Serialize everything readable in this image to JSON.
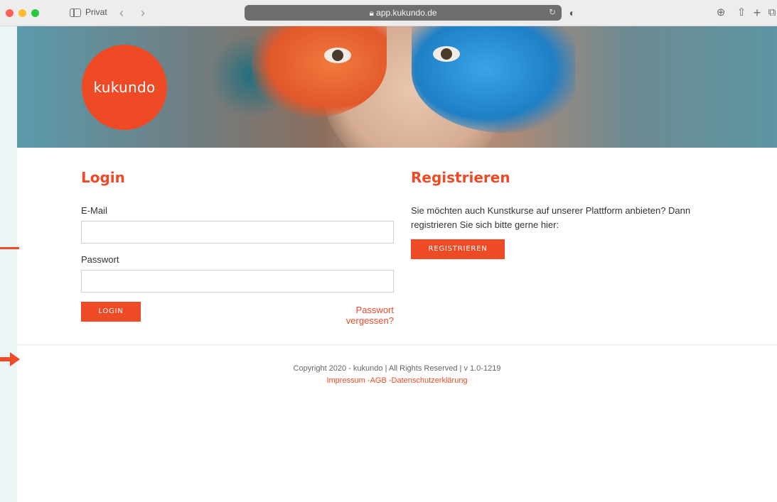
{
  "browser": {
    "private_label": "Privat",
    "url": "app.kukundo.de",
    "nav_back": "‹",
    "nav_forward": "›",
    "icons": [
      "sidebar-icon",
      "back-icon",
      "forward-icon",
      "lock-icon",
      "reload-icon",
      "shield-icon",
      "download-icon",
      "share-icon",
      "new-tab-icon",
      "tabs-icon"
    ]
  },
  "brand": {
    "logo_text": "kukundo",
    "accent": "#ef4a26"
  },
  "login": {
    "title": "Login",
    "email_label": "E-Mail",
    "email_value": "",
    "password_label": "Passwort",
    "password_value": "",
    "button_label": "LOGIN",
    "forgot_label": "Passwort vergessen?"
  },
  "register": {
    "title": "Registrieren",
    "text": "Sie möchten auch Kunstkurse auf unserer Plattform anbieten? Dann registrieren Sie sich bitte gerne hier:",
    "button_label": "REGISTRIEREN"
  },
  "footer": {
    "copyright": "Copyright 2020 - kukundo | All Rights Reserved | v 1.0-1219",
    "impressum": "Impressum",
    "separator_1": " -",
    "agb": "AGB",
    "separator_2": " -",
    "datenschutz": "Datenschutzerklärung"
  }
}
